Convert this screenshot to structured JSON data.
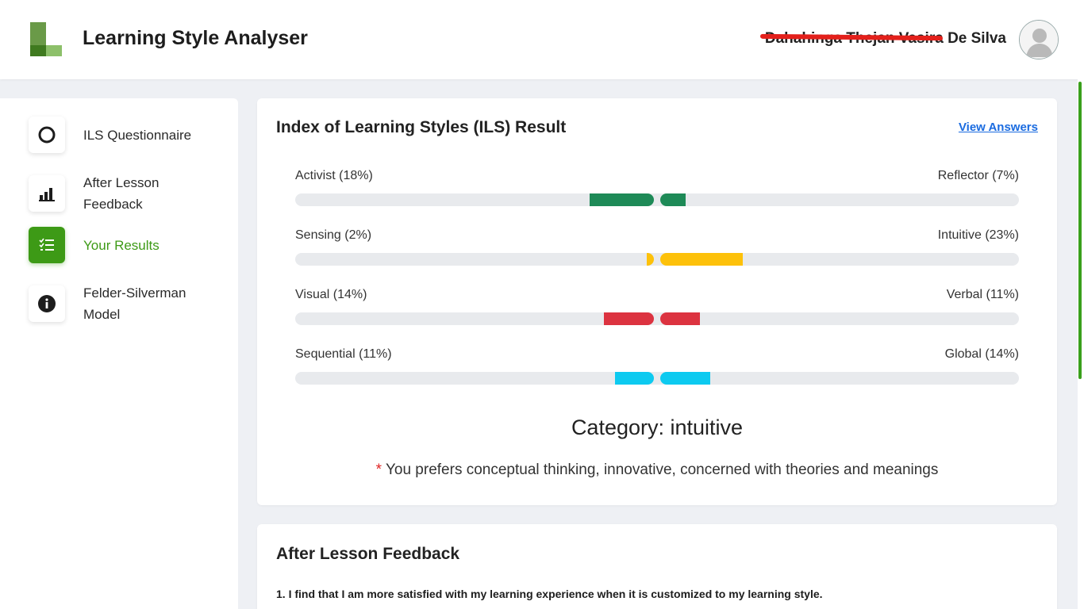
{
  "header": {
    "app_title": "Learning Style Analyser",
    "user_name": "Dahahinga Thejan Vasira De Silva",
    "avatar_icon": "user-avatar-icon"
  },
  "sidebar": {
    "items": [
      {
        "label": "ILS Questionnaire",
        "icon": "circle-outline-icon",
        "active": false
      },
      {
        "label": "After Lesson Feedback",
        "icon": "bar-chart-icon",
        "active": false
      },
      {
        "label": "Your Results",
        "icon": "checklist-icon",
        "active": true
      },
      {
        "label": "Felder-Silverman Model",
        "icon": "info-icon",
        "active": false
      }
    ]
  },
  "ils_card": {
    "title": "Index of Learning Styles (ILS) Result",
    "view_answers_label": "View Answers",
    "dimensions": [
      {
        "left_label": "Activist (18%)",
        "right_label": "Reflector (7%)",
        "left_value": 18,
        "right_value": 7,
        "color": "#1e8a57"
      },
      {
        "left_label": "Sensing (2%)",
        "right_label": "Intuitive (23%)",
        "left_value": 2,
        "right_value": 23,
        "color": "#fdc10a"
      },
      {
        "left_label": "Visual (14%)",
        "right_label": "Verbal (11%)",
        "left_value": 14,
        "right_value": 11,
        "color": "#dc3340"
      },
      {
        "left_label": "Sequential (11%)",
        "right_label": "Global (14%)",
        "left_value": 11,
        "right_value": 14,
        "color": "#0dcaf0"
      }
    ],
    "category_text": "Category: intuitive",
    "asterisk": "*",
    "description": "You prefers conceptual thinking, innovative, concerned with theories and meanings"
  },
  "feedback_card": {
    "title": "After Lesson Feedback",
    "question_1": "1. I find that I am more satisfied with my learning experience when it is customized to my learning style."
  },
  "colors": {
    "accent": "#3d9a16",
    "link": "#1a6be0",
    "track": "#e8eaed"
  }
}
